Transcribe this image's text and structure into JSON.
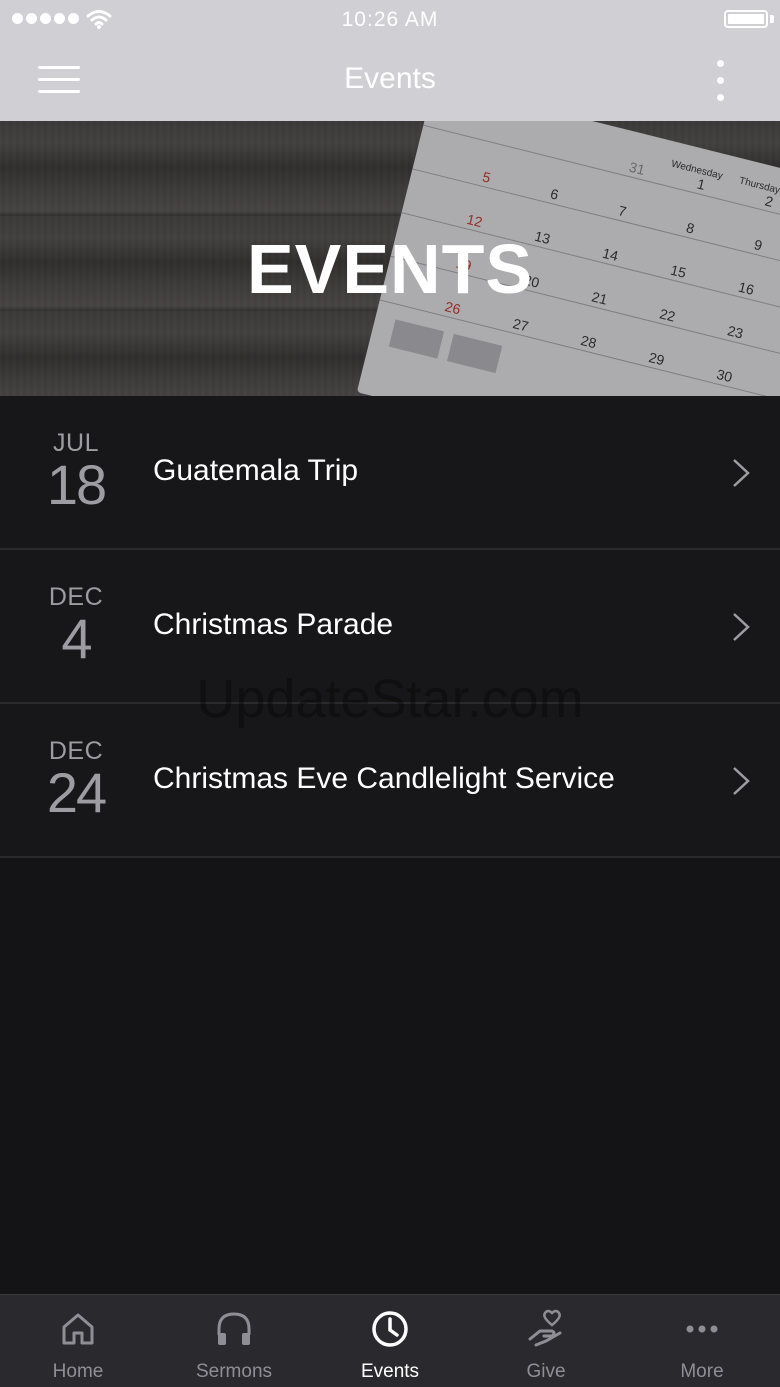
{
  "status_bar": {
    "time": "10:26 AM"
  },
  "nav": {
    "title": "Events"
  },
  "hero": {
    "title": "EVENTS",
    "calendar_numbers": [
      "31",
      "1",
      "2",
      "5",
      "6",
      "7",
      "8",
      "9",
      "12",
      "13",
      "14",
      "15",
      "16",
      "19",
      "20",
      "21",
      "22",
      "23",
      "26",
      "27",
      "28",
      "29",
      "30"
    ],
    "calendar_headers": [
      "Wednesday",
      "Thursday"
    ]
  },
  "events": [
    {
      "month": "JUL",
      "day": "18",
      "title": "Guatemala Trip"
    },
    {
      "month": "DEC",
      "day": "4",
      "title": "Christmas Parade"
    },
    {
      "month": "DEC",
      "day": "24",
      "title": "Christmas Eve Candlelight Service"
    }
  ],
  "watermark": "UpdateStar.com",
  "tabs": [
    {
      "label": "Home",
      "icon": "home-icon",
      "active": false
    },
    {
      "label": "Sermons",
      "icon": "headphones-icon",
      "active": false
    },
    {
      "label": "Events",
      "icon": "clock-icon",
      "active": true
    },
    {
      "label": "Give",
      "icon": "give-hand-heart-icon",
      "active": false
    },
    {
      "label": "More",
      "icon": "more-dots-icon",
      "active": false
    }
  ],
  "colors": {
    "background": "#141417",
    "bar": "#d0d0d4",
    "tab_bar": "#2a2a2e",
    "active_tab": "#ffffff",
    "inactive_tab": "#8e8e94"
  }
}
